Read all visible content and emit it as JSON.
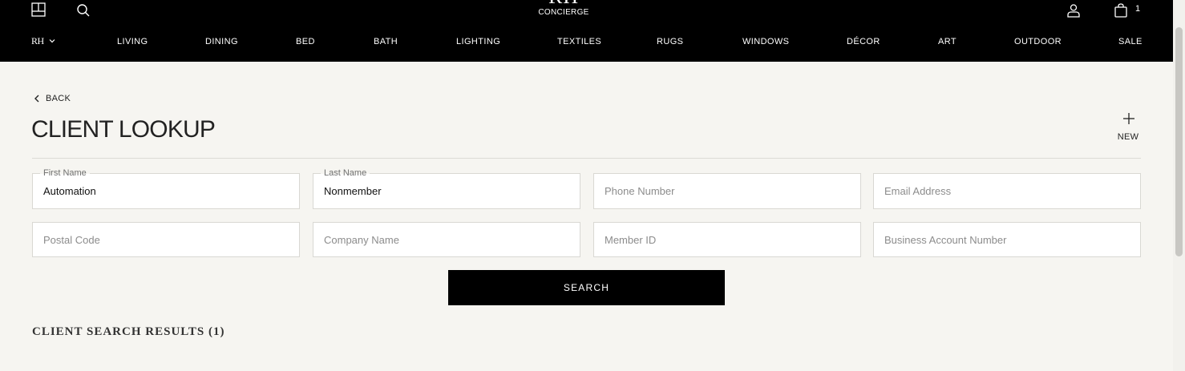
{
  "header": {
    "logo_mark": "RH",
    "logo_sub": "CONCIERGE",
    "brand_menu_label": "RH",
    "cart_count": "1",
    "nav": [
      {
        "label": "LIVING"
      },
      {
        "label": "DINING"
      },
      {
        "label": "BED"
      },
      {
        "label": "BATH"
      },
      {
        "label": "LIGHTING"
      },
      {
        "label": "TEXTILES"
      },
      {
        "label": "RUGS"
      },
      {
        "label": "WINDOWS"
      },
      {
        "label": "DÉCOR"
      },
      {
        "label": "ART"
      },
      {
        "label": "OUTDOOR"
      },
      {
        "label": "SALE"
      }
    ],
    "icons": [
      "layout-icon",
      "search-icon",
      "account-icon",
      "cart-icon",
      "chevron-down-icon"
    ]
  },
  "main": {
    "back_label": "BACK",
    "title": "CLIENT LOOKUP",
    "new_label": "NEW",
    "form": {
      "first_name": {
        "label": "First Name",
        "value": "Automation"
      },
      "last_name": {
        "label": "Last Name",
        "value": "Nonmember"
      },
      "phone": {
        "placeholder": "Phone Number",
        "value": ""
      },
      "email": {
        "placeholder": "Email Address",
        "value": ""
      },
      "postal_code": {
        "placeholder": "Postal Code",
        "value": ""
      },
      "company_name": {
        "placeholder": "Company Name",
        "value": ""
      },
      "member_id": {
        "placeholder": "Member ID",
        "value": ""
      },
      "business_account": {
        "placeholder": "Business Account Number",
        "value": ""
      }
    },
    "search_label": "SEARCH",
    "results_heading": "CLIENT SEARCH RESULTS (1)"
  },
  "colors": {
    "header_bg": "#000000",
    "page_bg": "#f6f5f1",
    "field_bg": "#ffffff",
    "button_bg": "#000000"
  }
}
